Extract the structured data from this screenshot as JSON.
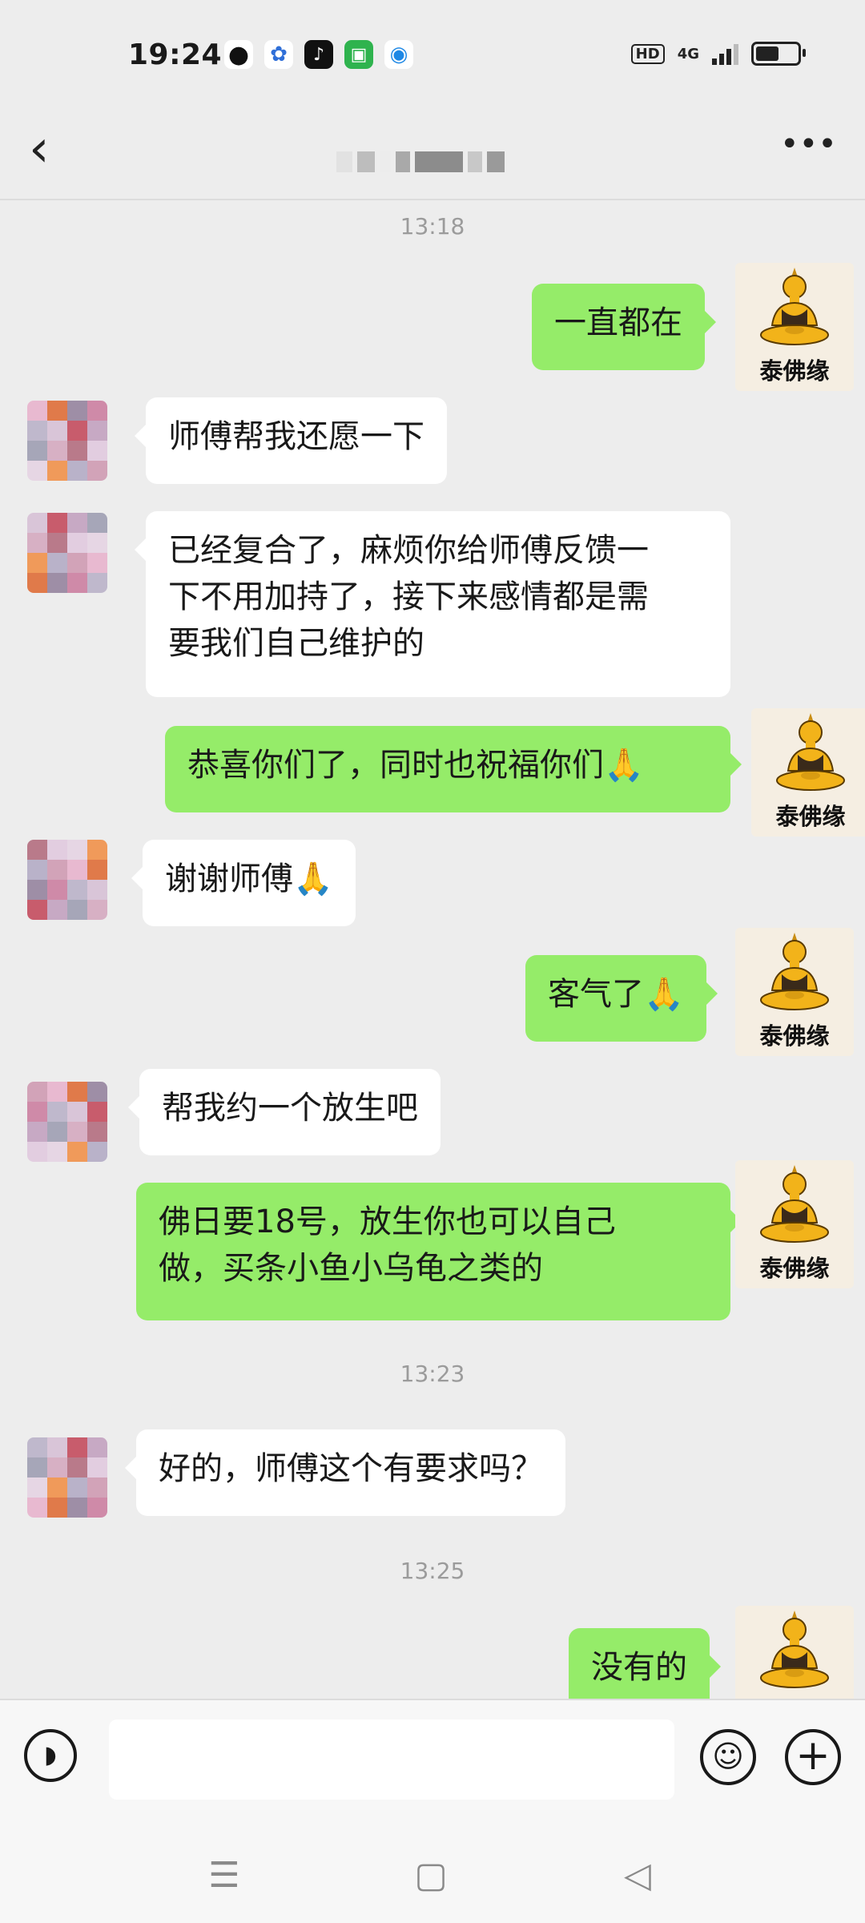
{
  "status_bar": {
    "time": "19:24",
    "hd": "HD",
    "network": "4G",
    "signal_level": 0.75,
    "battery_level": 0.55
  },
  "nav": {
    "back_icon": "chevron-left-icon",
    "more_icon": "more-dots-icon"
  },
  "chat": {
    "timestamps": [
      "13:18",
      "13:23",
      "13:25"
    ],
    "brand_name": "泰佛缘",
    "messages": [
      {
        "from": "me",
        "text": "一直都在"
      },
      {
        "from": "other",
        "text": "师傅帮我还愿一下"
      },
      {
        "from": "other",
        "lines": [
          "已经复合了，麻烦你给师傅反馈一",
          "下不用加持了，接下来感情都是需",
          "要我们自己维护的"
        ]
      },
      {
        "from": "me",
        "text": "恭喜你们了，同时也祝福你们🙏"
      },
      {
        "from": "other",
        "text": "谢谢师傅🙏"
      },
      {
        "from": "me",
        "text": "客气了🙏"
      },
      {
        "from": "other",
        "text": "帮我约一个放生吧"
      },
      {
        "from": "me",
        "lines": [
          "佛日要18号，放生你也可以自己",
          "做，买条小鱼小乌龟之类的"
        ]
      },
      {
        "from": "other",
        "text": "好的，师傅这个有要求吗？"
      },
      {
        "from": "me",
        "text": "没有的"
      }
    ]
  },
  "colors": {
    "my_bubble": "#95ec69",
    "other_bubble": "#ffffff",
    "background": "#ededed"
  }
}
